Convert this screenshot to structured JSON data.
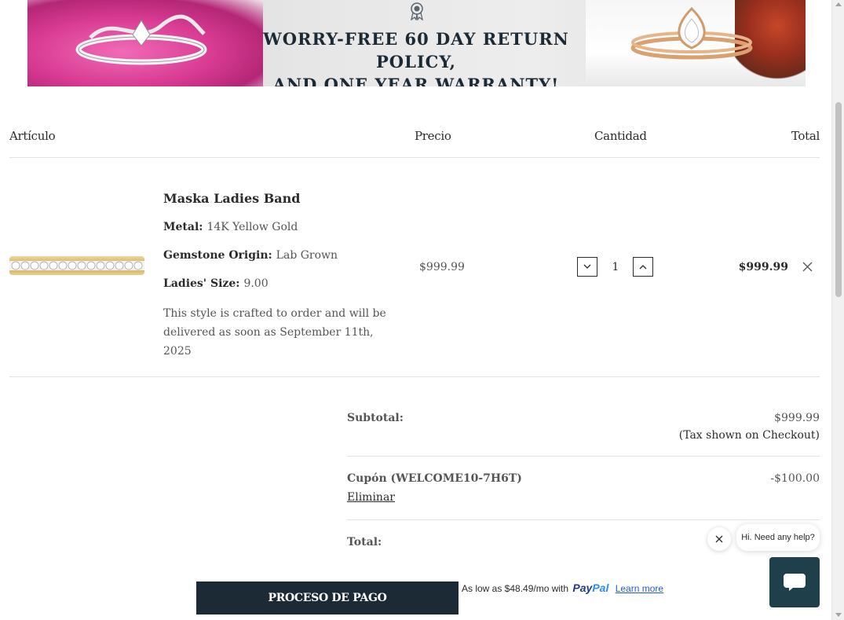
{
  "banner": {
    "line1": "WORRY-FREE 60 DAY RETURN POLICY,",
    "line2": "AND ONE YEAR WARRANTY!"
  },
  "cart_table": {
    "headers": {
      "item": "Artículo",
      "price": "Precio",
      "quantity": "Cantidad",
      "total": "Total"
    }
  },
  "line_item": {
    "name": "Maska Ladies Band",
    "attributes": [
      {
        "label": "Metal:",
        "value": "14K Yellow Gold"
      },
      {
        "label": "Gemstone Origin:",
        "value": "Lab Grown"
      },
      {
        "label": "Ladies' Size:",
        "value": "9.00"
      }
    ],
    "delivery_note": "This style is crafted to order and will be delivered as soon as September 11th, 2025",
    "price": "$999.99",
    "quantity": "1",
    "line_total": "$999.99"
  },
  "summary": {
    "subtotal_label": "Subtotal:",
    "subtotal_value": "$999.99",
    "tax_note": "(Tax shown on Checkout)",
    "coupon_label": "Cupón (WELCOME10-7H6T)",
    "coupon_value": "-$100.00",
    "coupon_remove": "Eliminar",
    "total_label": "Total:"
  },
  "checkout": {
    "button_label": "PROCESO DE PAGO",
    "paypal_prefix": "As low as $48.49/mo with",
    "paypal_logo_pay": "Pay",
    "paypal_logo_pal": "Pal",
    "paypal_learn_more": "Learn more"
  },
  "chat": {
    "bubble_text": "Hi. Need any help?"
  },
  "colors": {
    "navy": "#1c2a36",
    "chat_teal": "#1f3f4a",
    "paypal_blue": "#1f3a8a"
  }
}
